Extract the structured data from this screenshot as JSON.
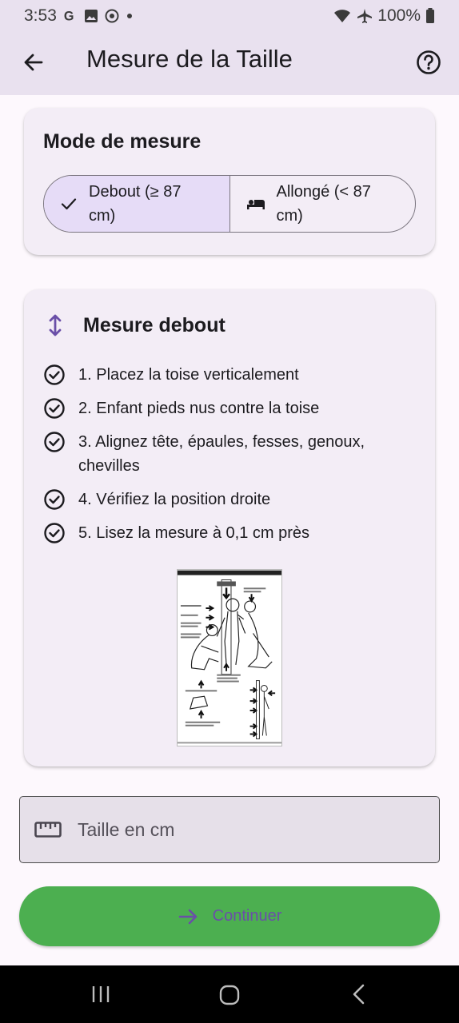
{
  "status_bar": {
    "time": "3:53",
    "battery": "100%",
    "icons": [
      "google-icon",
      "photo-icon",
      "target-icon",
      "dot-icon",
      "wifi-icon",
      "airplane-icon",
      "battery-icon"
    ]
  },
  "app_bar": {
    "title": "Mesure de la Taille",
    "back_icon": "arrow-left-icon",
    "help_icon": "help-circle-icon"
  },
  "mode_card": {
    "title": "Mode de mesure",
    "options": [
      {
        "label": "Debout (≥ 87 cm)",
        "icon": "check-icon",
        "selected": true
      },
      {
        "label": "Allongé (< 87 cm)",
        "icon": "bed-icon",
        "selected": false
      }
    ]
  },
  "measure_card": {
    "title": "Mesure debout",
    "icon": "vertical-arrows-icon",
    "steps": [
      "1. Placez la toise verticalement",
      "2. Enfant pieds nus contre la toise",
      "3. Alignez tête, épaules, fesses, genoux, chevilles",
      "4. Vérifiez la position droite",
      "5. Lisez la mesure à 0,1 cm près"
    ]
  },
  "height_input": {
    "placeholder": "Taille en cm",
    "value": "",
    "icon": "ruler-icon"
  },
  "continue_button": {
    "label": "Continuer",
    "icon": "arrow-right-icon"
  },
  "colors": {
    "app_bar_bg": "#e9e1ef",
    "card_bg": "#f3edf6",
    "selected_segment": "#e6dcf7",
    "continue_bg": "#4caf50",
    "accent_purple": "#6a4fa8"
  }
}
